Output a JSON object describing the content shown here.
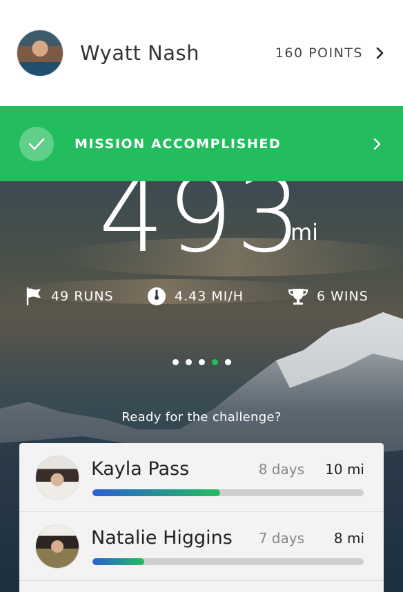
{
  "user": {
    "name": "Wyatt Nash",
    "points": "160 POINTS"
  },
  "mission": {
    "label": "MISSION ACCOMPLISHED"
  },
  "hero": {
    "distance": "493",
    "unit": "mi",
    "stats": [
      {
        "icon": "flag-icon",
        "label": "49 RUNS"
      },
      {
        "icon": "speedometer-icon",
        "label": "4.43 MI/H"
      },
      {
        "icon": "trophy-icon",
        "label": "6 WINS"
      }
    ],
    "pager": {
      "count": 5,
      "active_index": 3
    },
    "prompt": "Ready for the challenge?"
  },
  "leaderboard": [
    {
      "name": "Kayla Pass",
      "days": "8 days",
      "distance": "10 mi",
      "progress": 0.47
    },
    {
      "name": "Natalie Higgins",
      "days": "7 days",
      "distance": "8 mi",
      "progress": 0.19
    }
  ],
  "colors": {
    "accent": "#23bd5e",
    "progress_start": "#2b5fd6",
    "progress_end": "#23bd5e"
  }
}
